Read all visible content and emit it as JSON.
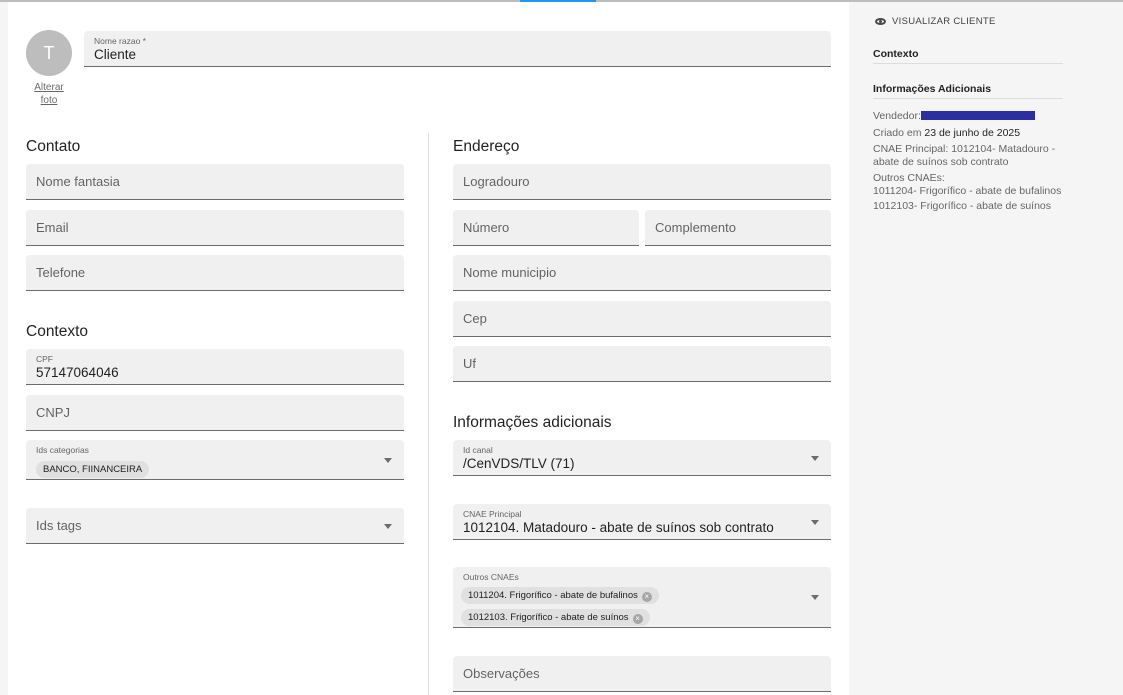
{
  "form": {
    "avatar_initial": "T",
    "change_photo": "Alterar foto",
    "nome_razao": {
      "label": "Nome razao *",
      "value": "Cliente"
    },
    "contato": {
      "title": "Contato",
      "nome_fantasia": "Nome fantasia",
      "email": "Email",
      "telefone": "Telefone"
    },
    "contexto": {
      "title": "Contexto",
      "cpf": {
        "label": "CPF",
        "value": "57147064046"
      },
      "cnpj": "CNPJ",
      "ids_categorias": {
        "label": "Ids categorias",
        "chips": [
          "BANCO, FIINANCEIRA"
        ]
      },
      "ids_tags": "Ids tags"
    },
    "endereco": {
      "title": "Endereço",
      "logradouro": "Logradouro",
      "numero": "Número",
      "complemento": "Complemento",
      "nome_municipio": "Nome municipio",
      "cep": "Cep",
      "uf": "Uf"
    },
    "info_adicionais": {
      "title": "Informações adicionais",
      "id_canal": {
        "label": "Id canal",
        "value": "/CenVDS/TLV (71)"
      },
      "cnae_principal": {
        "label": "CNAE Principal",
        "value": "1012104. Matadouro - abate de suínos sob contrato"
      },
      "outros_cnaes": {
        "label": "Outros CNAEs",
        "chips": [
          "1011204. Frigorífico - abate de bufalinos",
          "1012103. Frigorífico - abate de suínos"
        ]
      },
      "observacoes": "Observações"
    }
  },
  "sidebar": {
    "view_button": "VISUALIZAR CLIENTE",
    "contexto_title": "Contexto",
    "info_title": "Informações Adicionais",
    "vendedor_label": "Vendedor:",
    "criado_prefix": "Criado em ",
    "criado_date": "23 de junho de 2025",
    "cnae_principal": "CNAE Principal: 1012104- Matadouro - abate de suínos sob contrato",
    "outros_label": "Outros CNAEs:",
    "outros": [
      "1011204- Frigorífico - abate de bufalinos",
      "1012103- Frigorífico - abate de suínos"
    ]
  },
  "colors": {
    "accent": "#2196f3",
    "field_bg": "#f0f0f0",
    "avatar_bg": "#bdbdbd",
    "redaction": "#2c2f9e"
  }
}
